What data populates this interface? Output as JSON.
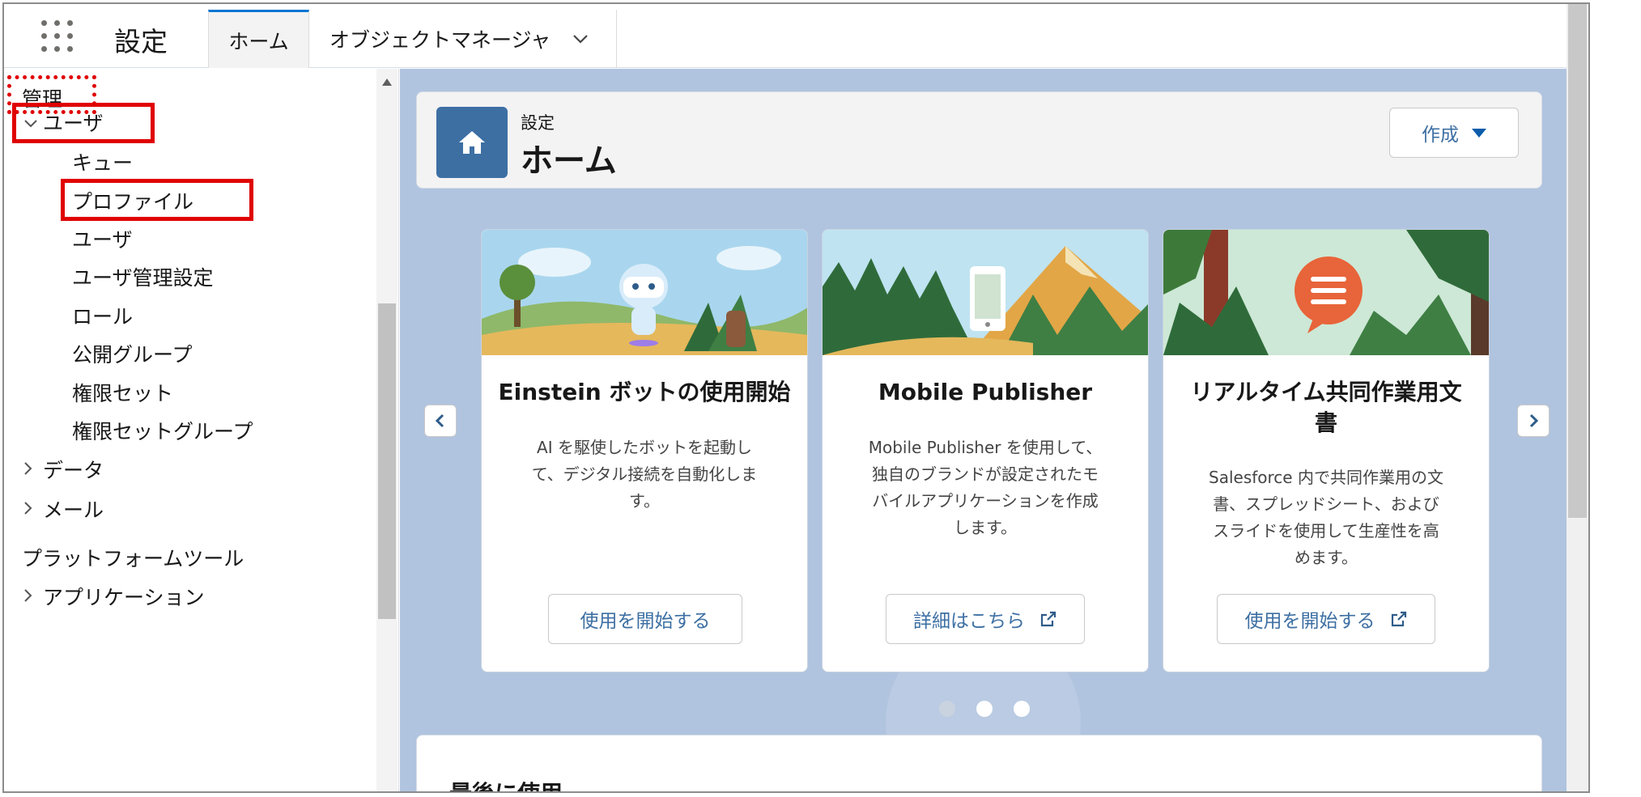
{
  "topnav": {
    "app_title": "設定",
    "tabs": [
      {
        "label": "ホーム"
      },
      {
        "label": "オブジェクトマネージャ"
      }
    ]
  },
  "sidebar": {
    "section_admin": "管理",
    "group_users": "ユーザ",
    "items": [
      "キュー",
      "プロファイル",
      "ユーザ",
      "ユーザ管理設定",
      "ロール",
      "公開グループ",
      "権限セット",
      "権限セットグループ"
    ],
    "group_data": "データ",
    "group_mail": "メール",
    "section_platform": "プラットフォームツール",
    "group_apps": "アプリケーション"
  },
  "header": {
    "subtitle": "設定",
    "title": "ホーム",
    "create_label": "作成"
  },
  "cards": [
    {
      "title": "Einstein ボットの使用開始",
      "desc_lines": [
        "AI を駆使したボットを起動し",
        "て、デジタル接続を自動化しま",
        "す。"
      ],
      "button": "使用を開始する"
    },
    {
      "title": "Mobile Publisher",
      "desc_lines": [
        "Mobile Publisher を使用して、",
        "独自のブランドが設定されたモ",
        "バイルアプリケーションを作成",
        "します。"
      ],
      "button": "詳細はこちら"
    },
    {
      "title_lines": [
        "リアルタイム共同作業用文",
        "書"
      ],
      "desc_lines": [
        "Salesforce 内で共同作業用の文",
        "書、スプレッドシート、および",
        "スライドを使用して生産性を高",
        "めます。"
      ],
      "button": "使用を開始する"
    }
  ],
  "carousel": {
    "total_pages": 3,
    "active_page": 1
  },
  "recent": {
    "title": "最後に使用"
  },
  "colors": {
    "accent": "#0176d3",
    "brand_icon": "#3d6fa3",
    "highlight": "#e00000",
    "background": "#b0c4df"
  }
}
